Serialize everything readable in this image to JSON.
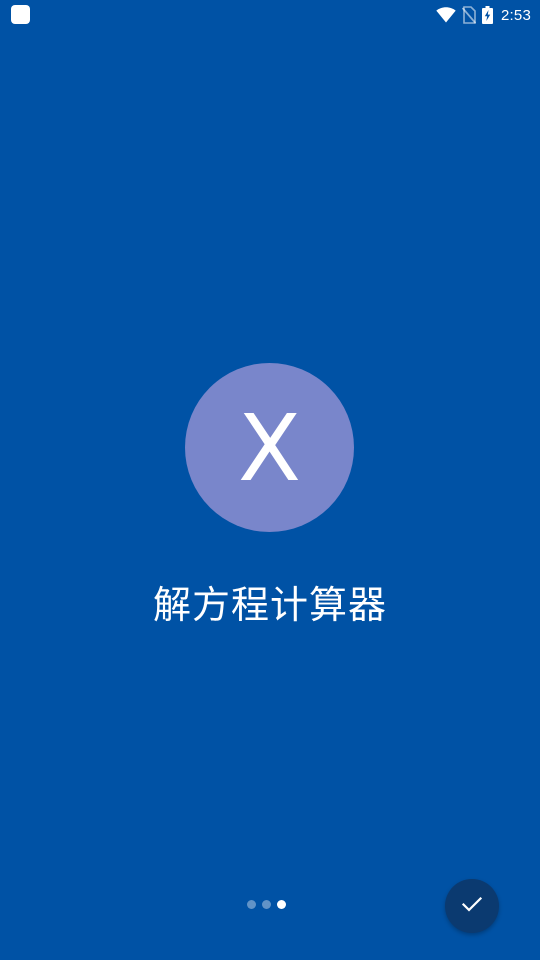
{
  "status_bar": {
    "time": "2:53",
    "icons": [
      "app-notification-icon",
      "wifi-icon",
      "no-sim-icon",
      "battery-charging-icon"
    ]
  },
  "onboarding": {
    "logo_letter": "X",
    "app_name": "解方程计算器",
    "page_count": 3,
    "current_page": 3
  },
  "actions": {
    "done_icon": "check-icon"
  },
  "colors": {
    "background": "#0052A5",
    "logo_circle": "#7986CB",
    "fab": "#0B3A70",
    "text": "#FFFFFF"
  }
}
